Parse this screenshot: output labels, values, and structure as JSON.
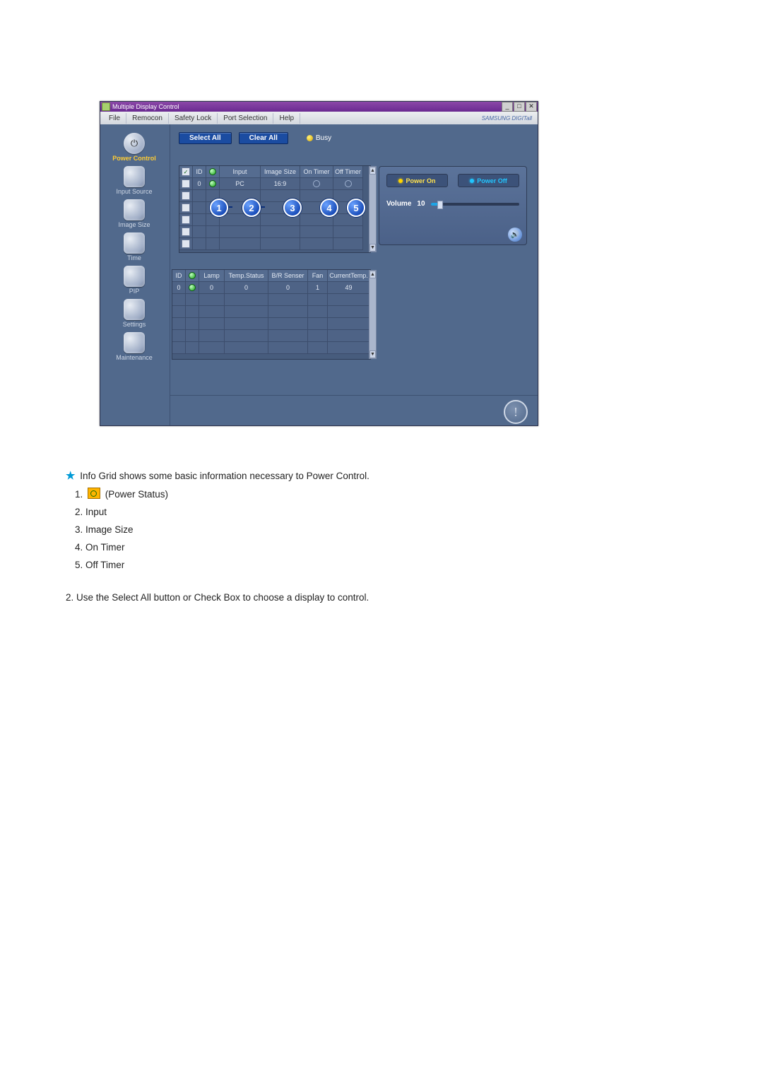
{
  "window": {
    "title": "Multiple Display Control",
    "brand": "SAMSUNG DIGITall"
  },
  "menu": [
    "File",
    "Remocon",
    "Safety Lock",
    "Port Selection",
    "Help"
  ],
  "sidebar": [
    {
      "label": "Power Control",
      "active": true
    },
    {
      "label": "Input Source"
    },
    {
      "label": "Image Size"
    },
    {
      "label": "Time"
    },
    {
      "label": "PIP"
    },
    {
      "label": "Settings"
    },
    {
      "label": "Maintenance"
    }
  ],
  "toolbar": {
    "select_all": "Select All",
    "clear_all": "Clear All",
    "busy": "Busy"
  },
  "table1": {
    "headers": [
      "",
      "ID",
      "",
      "Input",
      "Image Size",
      "On Timer",
      "Off Timer"
    ],
    "rows": [
      {
        "checked": true,
        "id": "0",
        "input": "PC",
        "size": "16:9"
      },
      {
        "checked": false
      },
      {
        "checked": false
      },
      {
        "checked": false
      },
      {
        "checked": false
      },
      {
        "checked": false
      }
    ]
  },
  "table2": {
    "headers": [
      "ID",
      "",
      "Lamp",
      "Temp.Status",
      "B/R Senser",
      "Fan",
      "CurrentTemp."
    ],
    "rows": [
      {
        "id": "0",
        "lamp": "0",
        "temp": "0",
        "br": "0",
        "fan": "1",
        "ct": "49"
      },
      {},
      {},
      {},
      {},
      {}
    ]
  },
  "callouts": [
    "1",
    "2",
    "3",
    "4",
    "5"
  ],
  "power": {
    "on_label": "Power On",
    "off_label": "Power Off",
    "volume_label": "Volume",
    "volume_value": "10",
    "volume_percent": 10
  },
  "instructions": {
    "lead": "Info Grid shows some basic information necessary to Power Control.",
    "i1_suffix": "(Power Status)",
    "i2": "Input",
    "i3": "Image Size",
    "i4": "On Timer",
    "i5": "Off Timer",
    "second": "2.  Use the Select All button or Check Box to choose a display to control."
  }
}
